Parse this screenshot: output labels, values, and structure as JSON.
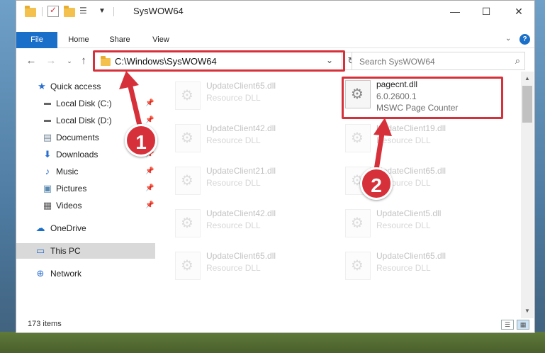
{
  "window": {
    "title": "SysWOW64",
    "controls": [
      "—",
      "☐",
      "✕"
    ]
  },
  "ribbon": {
    "tabs": [
      "File",
      "Home",
      "Share",
      "View"
    ]
  },
  "address": {
    "path": "C:\\Windows\\SysWOW64",
    "search_placeholder": "Search SysWOW64"
  },
  "sidebar": {
    "items": [
      {
        "label": "Quick access",
        "icon": "star-icon",
        "pinned": false
      },
      {
        "label": "Local Disk (C:)",
        "icon": "drive-icon",
        "pinned": true
      },
      {
        "label": "Local Disk (D:)",
        "icon": "drive-icon",
        "pinned": true
      },
      {
        "label": "Documents",
        "icon": "documents-icon",
        "pinned": true
      },
      {
        "label": "Downloads",
        "icon": "download-icon",
        "pinned": true
      },
      {
        "label": "Music",
        "icon": "music-icon",
        "pinned": true
      },
      {
        "label": "Pictures",
        "icon": "pictures-icon",
        "pinned": true
      },
      {
        "label": "Videos",
        "icon": "videos-icon",
        "pinned": true
      },
      {
        "label": "OneDrive",
        "icon": "cloud-icon",
        "pinned": false
      },
      {
        "label": "This PC",
        "icon": "computer-icon",
        "pinned": false
      },
      {
        "label": "Network",
        "icon": "network-icon",
        "pinned": false
      }
    ]
  },
  "files": {
    "left_column": [
      {
        "name": "UpdateClient65.dll",
        "type": "Resource DLL"
      },
      {
        "name": "UpdateClient42.dll",
        "type": "Resource DLL"
      },
      {
        "name": "UpdateClient21.dll",
        "type": "Resource DLL"
      },
      {
        "name": "UpdateClient42.dll",
        "type": "Resource DLL"
      },
      {
        "name": "UpdateClient65.dll",
        "type": "Resource DLL"
      }
    ],
    "right_column": [
      {
        "name": "pagecnt.dll",
        "version": "6.0.2600.1",
        "type": "MSWC Page Counter"
      },
      {
        "name": "UpdateClient19.dll",
        "type": "Resource DLL"
      },
      {
        "name": "UpdateClient65.dll",
        "type": "Resource DLL"
      },
      {
        "name": "UpdateClient5.dll",
        "type": "Resource DLL"
      },
      {
        "name": "UpdateClient65.dll",
        "type": "Resource DLL"
      }
    ]
  },
  "status": {
    "item_count": "173 items"
  },
  "annotations": {
    "badge1": "1",
    "badge2": "2",
    "color": "#d6313a"
  }
}
